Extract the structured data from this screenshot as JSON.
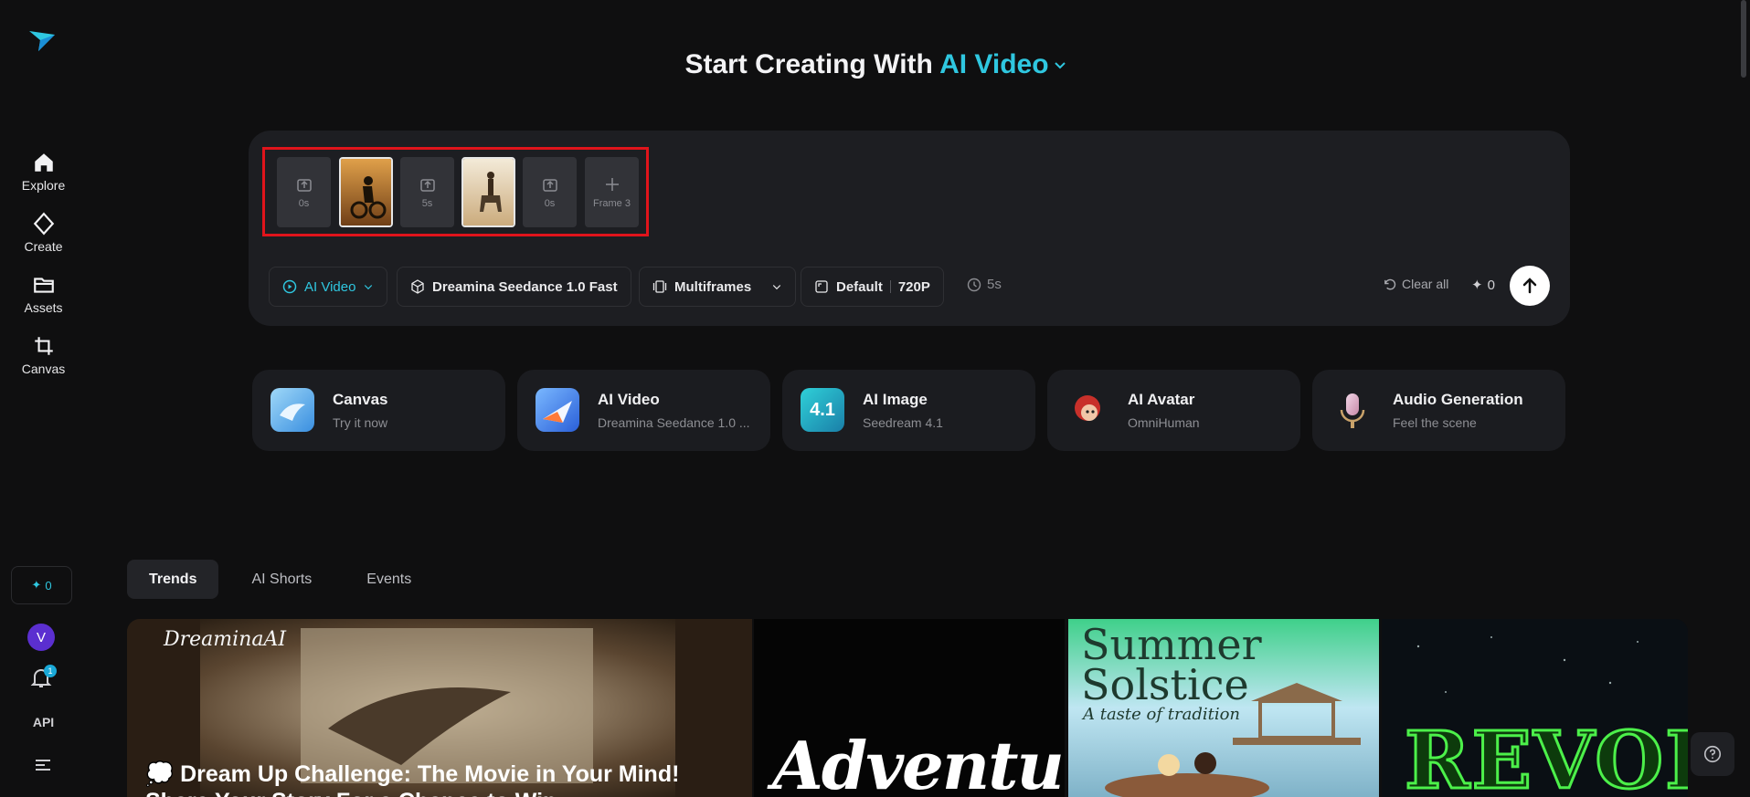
{
  "sidebar": {
    "items": [
      {
        "label": "Explore"
      },
      {
        "label": "Create"
      },
      {
        "label": "Assets"
      },
      {
        "label": "Canvas"
      }
    ],
    "credits": "0",
    "avatar_letter": "V",
    "notifications": "1",
    "api_label": "API"
  },
  "header": {
    "prefix": "Start Creating With",
    "mode": "AI Video"
  },
  "composer": {
    "frames": [
      {
        "kind": "slot",
        "label": "0s"
      },
      {
        "kind": "image",
        "label": "motocross rider image"
      },
      {
        "kind": "slot",
        "label": "5s"
      },
      {
        "kind": "image",
        "label": "horse rider image"
      },
      {
        "kind": "slot",
        "label": "0s"
      },
      {
        "kind": "add",
        "label": "Frame 3"
      }
    ],
    "mode_pill": "AI Video",
    "model_pill": "Dreamina Seedance 1.0 Fast",
    "frames_pill": "Multiframes",
    "ratio": "Default",
    "resolution": "720P",
    "duration": "5s",
    "clear_all": "Clear all",
    "credit_cost": "0"
  },
  "tools": [
    {
      "title": "Canvas",
      "subtitle": "Try it now"
    },
    {
      "title": "AI Video",
      "subtitle": "Dreamina Seedance 1.0 ..."
    },
    {
      "title": "AI Image",
      "subtitle": "Seedream 4.1"
    },
    {
      "title": "AI Avatar",
      "subtitle": "OmniHuman"
    },
    {
      "title": "Audio Generation",
      "subtitle": "Feel the scene"
    }
  ],
  "tabs": [
    {
      "label": "Trends"
    },
    {
      "label": "AI Shorts"
    },
    {
      "label": "Events"
    }
  ],
  "gallery": {
    "item1_brand": "DreaminaAI",
    "item1_title": "💭 Dream Up Challenge: The Movie in Your Mind! Share Your Story For a Chance to Win",
    "item2_text": "Adventure",
    "item3_title": "Summer Solstice",
    "item3_sub": "A taste of tradition",
    "item4_text": "REVOLT"
  },
  "colors": {
    "accent": "#2fc7e0",
    "highlight_outline": "#e0141b",
    "background": "#0f0f10"
  }
}
